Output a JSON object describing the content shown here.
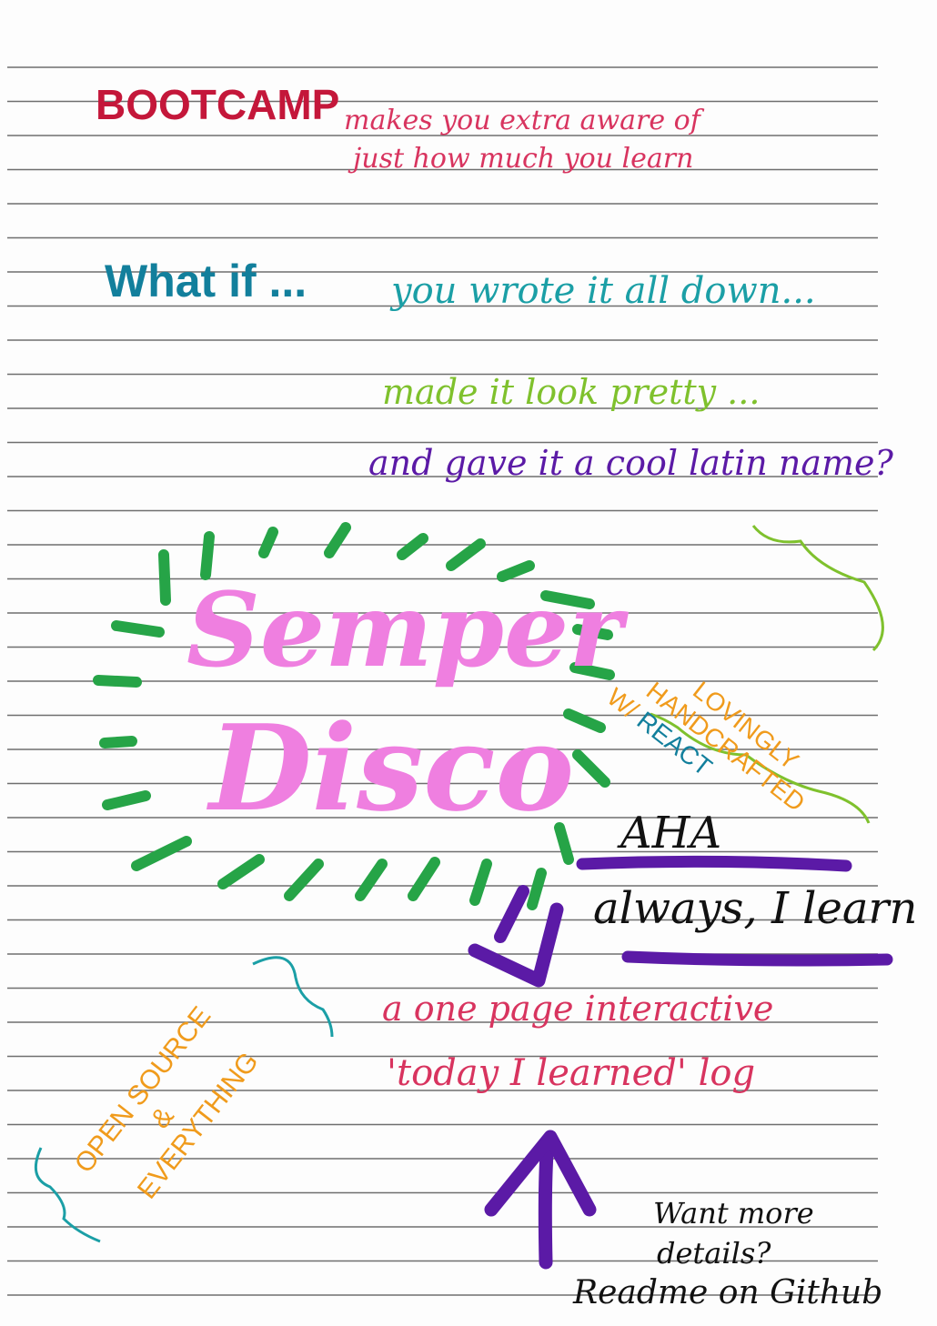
{
  "note": {
    "headline_word": "BOOTCAMP",
    "headline_rest_line1": "makes you extra aware of",
    "headline_rest_line2": "just how much you learn",
    "what_if": "What if ...",
    "clause1": "you wrote it all down...",
    "clause2": "made it look pretty ...",
    "clause3": "and gave it a cool latin name?",
    "title_line1": "Semper",
    "title_line2": "Disco",
    "side_line1": "LOVINGLY",
    "side_line2": "HANDCRAFTED",
    "side_line3": "W/",
    "side_line4": "REACT",
    "aha": "AHA",
    "always": "always, I learn",
    "desc_line1": "a one page interactive",
    "desc_line2": "'today I learned' log",
    "open_line1": "OPEN SOURCE",
    "open_line2": "&",
    "open_line3": "EVERYTHING",
    "want_line1": "Want more",
    "want_line2": "details?",
    "want_line3": "Readme on Github"
  },
  "colors": {
    "red": "#c4173a",
    "pink_red": "#d8345f",
    "teal": "#127f9c",
    "cyan": "#1b9fa6",
    "lime": "#7fc12d",
    "purple": "#5b1aa6",
    "pink": "#ef7fe0",
    "green": "#26a447",
    "orange": "#f09b1c",
    "black": "#111111",
    "ruling": "#6f6f6f"
  }
}
